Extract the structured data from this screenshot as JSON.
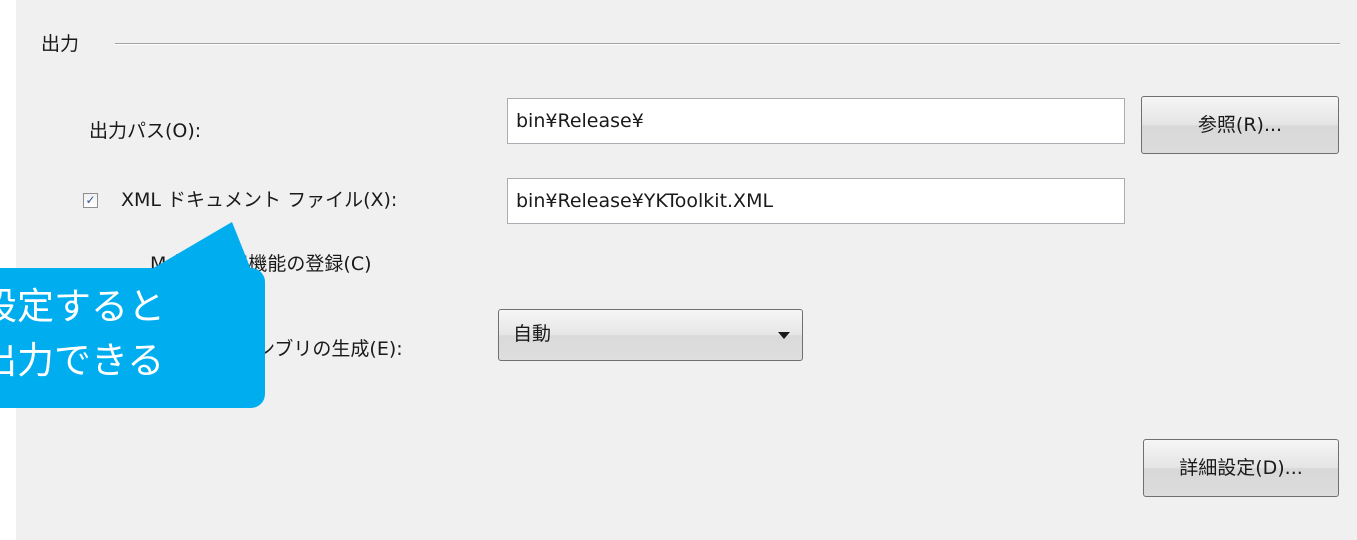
{
  "section": {
    "header": "出力"
  },
  "output_path": {
    "label": "出力パス(O):",
    "value": "bin¥Release¥",
    "browse_button": "参照(R)..."
  },
  "xml_doc": {
    "checked": true,
    "check_mark": "✓",
    "label": "XML ドキュメント ファイル(X):",
    "value": "bin¥Release¥YKToolkit.XML"
  },
  "com_interop": {
    "label": "M 相互運用機能の登録(C)"
  },
  "serialization": {
    "label": "ンブリの生成(E):",
    "selected": "自動"
  },
  "advanced_button": "詳細設定(D)...",
  "callout": {
    "line1": "設定すると",
    "line2": "出力できる",
    "color": "#00aeef"
  }
}
